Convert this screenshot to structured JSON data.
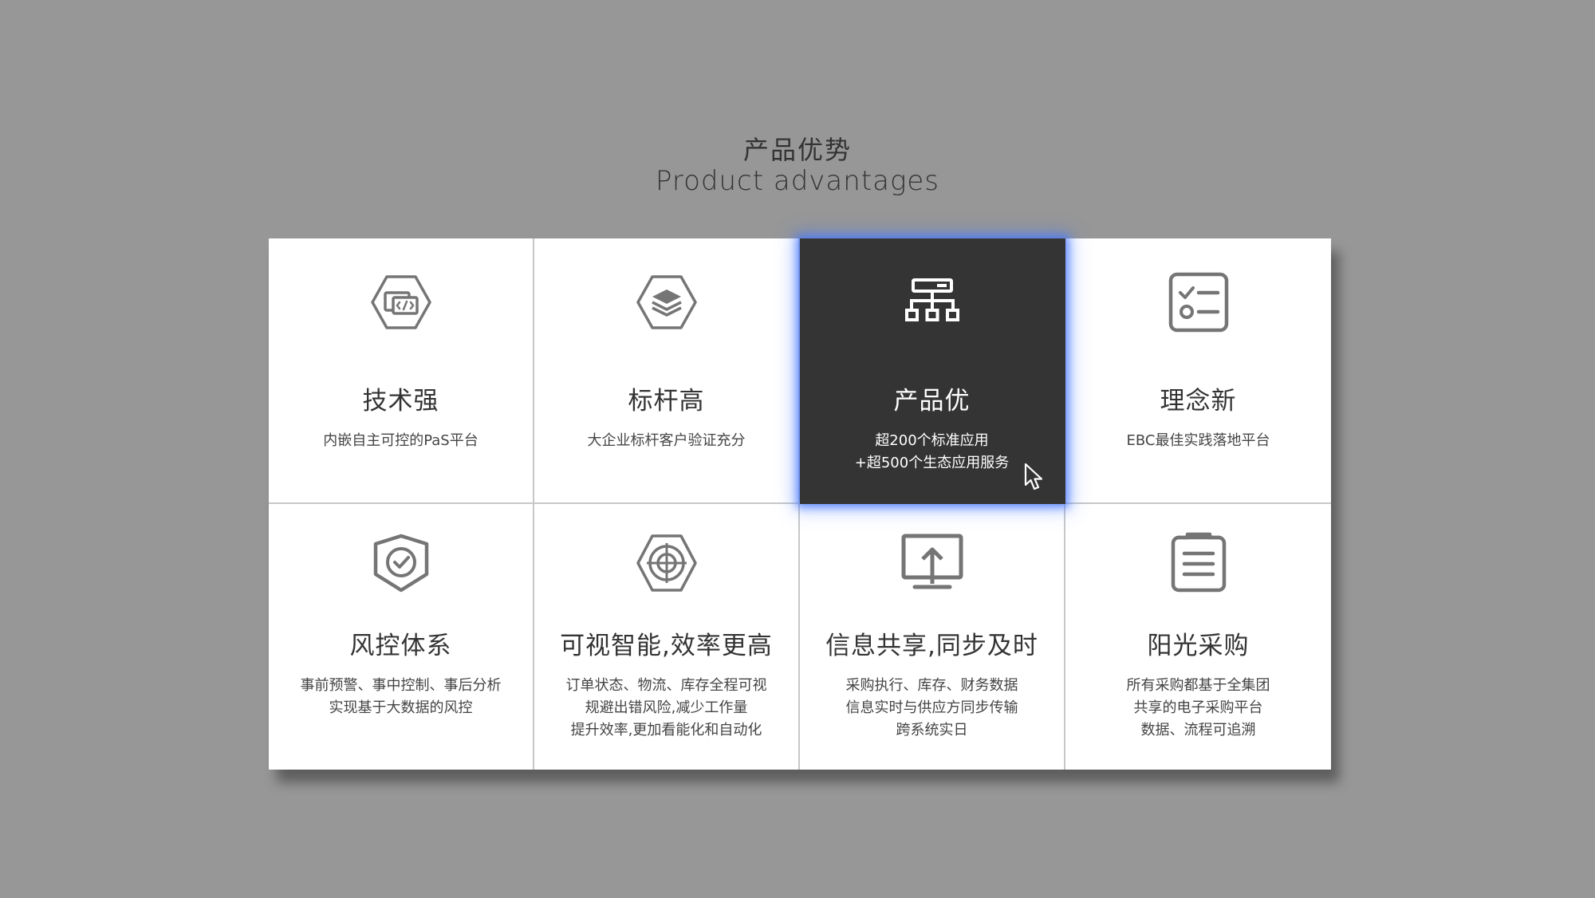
{
  "header": {
    "title_cn": "产品优势",
    "title_en": "Product advantages"
  },
  "colors": {
    "background": "#979797",
    "card": "#ffffff",
    "active_card": "#343434",
    "icon": "#757575",
    "glow": "#4678ff"
  },
  "cards": [
    {
      "icon": "code-window-hexagon-icon",
      "title": "技术强",
      "lines": [
        "内嵌自主可控的PaS平台"
      ]
    },
    {
      "icon": "layers-hexagon-icon",
      "title": "标杆高",
      "lines": [
        "大企业标杆客户验证充分"
      ]
    },
    {
      "icon": "network-hierarchy-icon",
      "title": "产品优",
      "lines": [
        "超200个标准应用",
        "+超500个生态应用服务"
      ],
      "active": true
    },
    {
      "icon": "checklist-icon",
      "title": "理念新",
      "lines": [
        "EBC最佳实践落地平台"
      ]
    },
    {
      "icon": "shield-check-icon",
      "title": "风控体系",
      "lines": [
        "事前预警、事中控制、事后分析",
        "实现基于大数据的风控"
      ]
    },
    {
      "icon": "target-hexagon-icon",
      "title": "可视智能,效率更高",
      "lines": [
        "订单状态、物流、库存全程可视",
        "规避出错风险,减少工作量",
        "提升效率,更加看能化和自动化"
      ]
    },
    {
      "icon": "monitor-upload-icon",
      "title": "信息共享,同步及时",
      "lines": [
        "采购执行、库存、财务数据",
        "信息实时与供应方同步传输",
        "跨系统实日"
      ]
    },
    {
      "icon": "document-list-icon",
      "title": "阳光采购",
      "lines": [
        "所有采购都基于全集团",
        "共享的电子采购平台",
        "数据、流程可追溯"
      ]
    }
  ]
}
